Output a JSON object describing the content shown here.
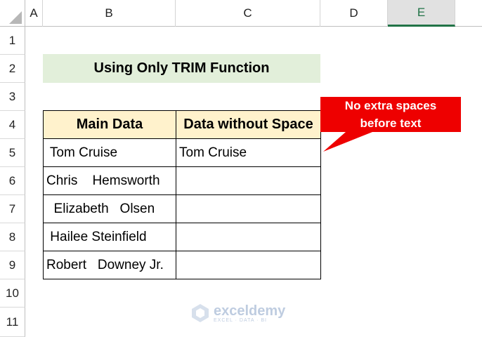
{
  "columns": [
    "A",
    "B",
    "C",
    "D",
    "E"
  ],
  "selected_column": "E",
  "rows": [
    "1",
    "2",
    "3",
    "4",
    "5",
    "6",
    "7",
    "8",
    "9",
    "10",
    "11"
  ],
  "title": "Using Only TRIM Function",
  "table": {
    "headers": [
      "Main Data",
      "Data without Space"
    ],
    "rows": [
      {
        "main": " Tom Cruise",
        "result": "Tom Cruise"
      },
      {
        "main": "Chris    Hemsworth",
        "result": ""
      },
      {
        "main": "  Elizabeth   Olsen",
        "result": ""
      },
      {
        "main": " Hailee Steinfield",
        "result": ""
      },
      {
        "main": "Robert   Downey Jr.",
        "result": ""
      }
    ]
  },
  "callout": {
    "line1": "No extra spaces",
    "line2": "before text",
    "color": "#ee0000"
  },
  "watermark": {
    "name": "exceldemy",
    "tagline": "EXCEL · DATA · BI"
  },
  "colors": {
    "title_fill": "#e2efda",
    "header_fill": "#fff2cc",
    "excel_green": "#217346"
  }
}
